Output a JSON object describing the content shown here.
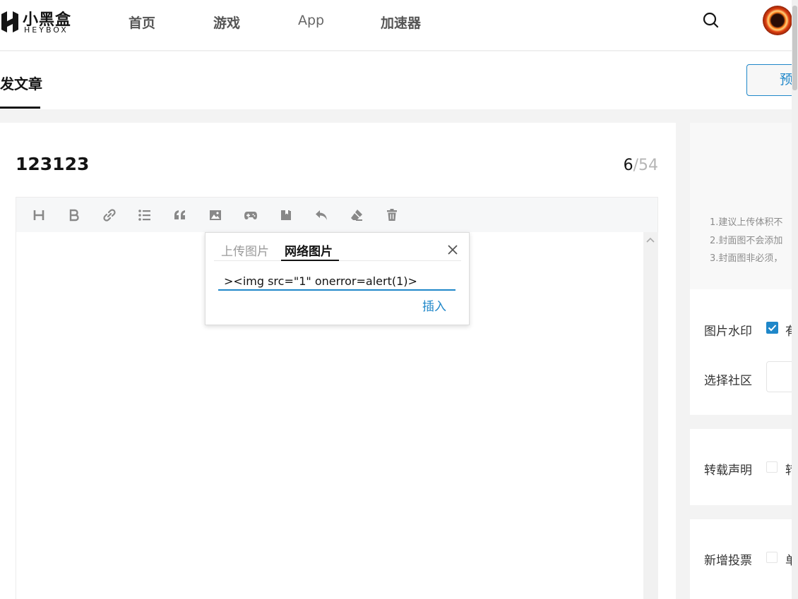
{
  "nav": {
    "logo_cn": "小黑盒",
    "logo_en": "HEYBOX",
    "items": [
      "首页",
      "游戏",
      "App",
      "加速器"
    ]
  },
  "subheader": {
    "tab": "发文章",
    "preview_button": "预"
  },
  "editor": {
    "title": "123123",
    "count_current": "6",
    "count_max": "/54",
    "toolbar_icons": [
      "heading-icon",
      "bold-icon",
      "link-icon",
      "list-icon",
      "quote-icon",
      "image-icon",
      "game-icon",
      "book-icon",
      "undo-icon",
      "eraser-icon",
      "trash-icon"
    ]
  },
  "image_popover": {
    "tab_upload": "上传图片",
    "tab_network": "网络图片",
    "url_value": "><img src=\"1\" onerror=alert(1)>",
    "insert_label": "插入"
  },
  "right_panel": {
    "tips": [
      "1.建议上传体积不",
      "2.封面图不会添加",
      "3.封面图非必须，"
    ],
    "watermark_label": "图片水印",
    "watermark_option": "有",
    "watermark_checked": true,
    "community_label": "选择社区",
    "repost_label": "转载声明",
    "repost_option": "转",
    "repost_checked": false,
    "vote_label": "新增投票",
    "vote_option": "单",
    "vote_checked": false
  },
  "colors": {
    "accent": "#1f87c9",
    "text": "#141414",
    "muted": "#b5b5b5"
  }
}
